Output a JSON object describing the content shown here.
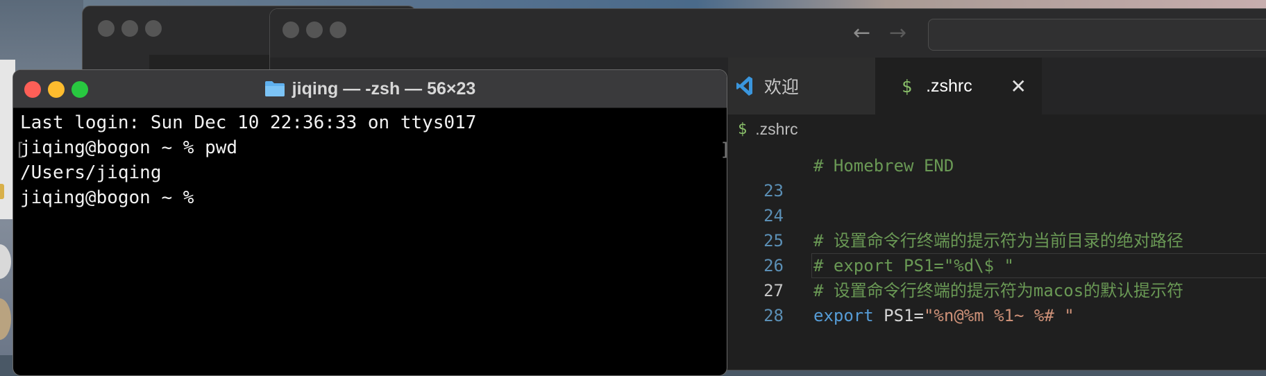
{
  "terminal": {
    "title": "jiqing — -zsh — 56×23",
    "lines": [
      "Last login: Sun Dec 10 22:36:33 on ttys017",
      "jiqing@bogon ~ % pwd",
      "/Users/jiqing",
      "jiqing@bogon ~ %"
    ],
    "traffic_lights": {
      "close": "#fe5f57",
      "minimize": "#febc2e",
      "zoom": "#28c840"
    }
  },
  "vscode": {
    "tabs": [
      {
        "label": "欢迎",
        "icon": "vscode-logo-icon"
      },
      {
        "label": ".zshrc",
        "icon": "dollar-icon",
        "active": true,
        "close_glyph": "✕"
      }
    ],
    "nav": {
      "back": "←",
      "forward": "→"
    },
    "breadcrumb": {
      "icon_glyph": "$",
      "label": ".zshrc"
    },
    "editor": {
      "partial_line": "# Homebrew END",
      "lines": [
        {
          "number": "23",
          "text": ""
        },
        {
          "number": "24",
          "text": "# 设置命令行终端的提示符为当前目录的绝对路径"
        },
        {
          "number": "25",
          "text": "# export PS1=\"%d\\$ \""
        },
        {
          "number": "26",
          "text": "# 设置命令行终端的提示符为macos的默认提示符"
        },
        {
          "number": "27",
          "keyword": "export",
          "variable": " PS1=",
          "string": "\"%n@%m %1~ %# \""
        },
        {
          "number": "28",
          "text": ""
        }
      ]
    },
    "colors": {
      "comment": "#6a9955",
      "keyword": "#569cd6",
      "string": "#ce9178",
      "line_number": "#5b8fb5"
    }
  }
}
